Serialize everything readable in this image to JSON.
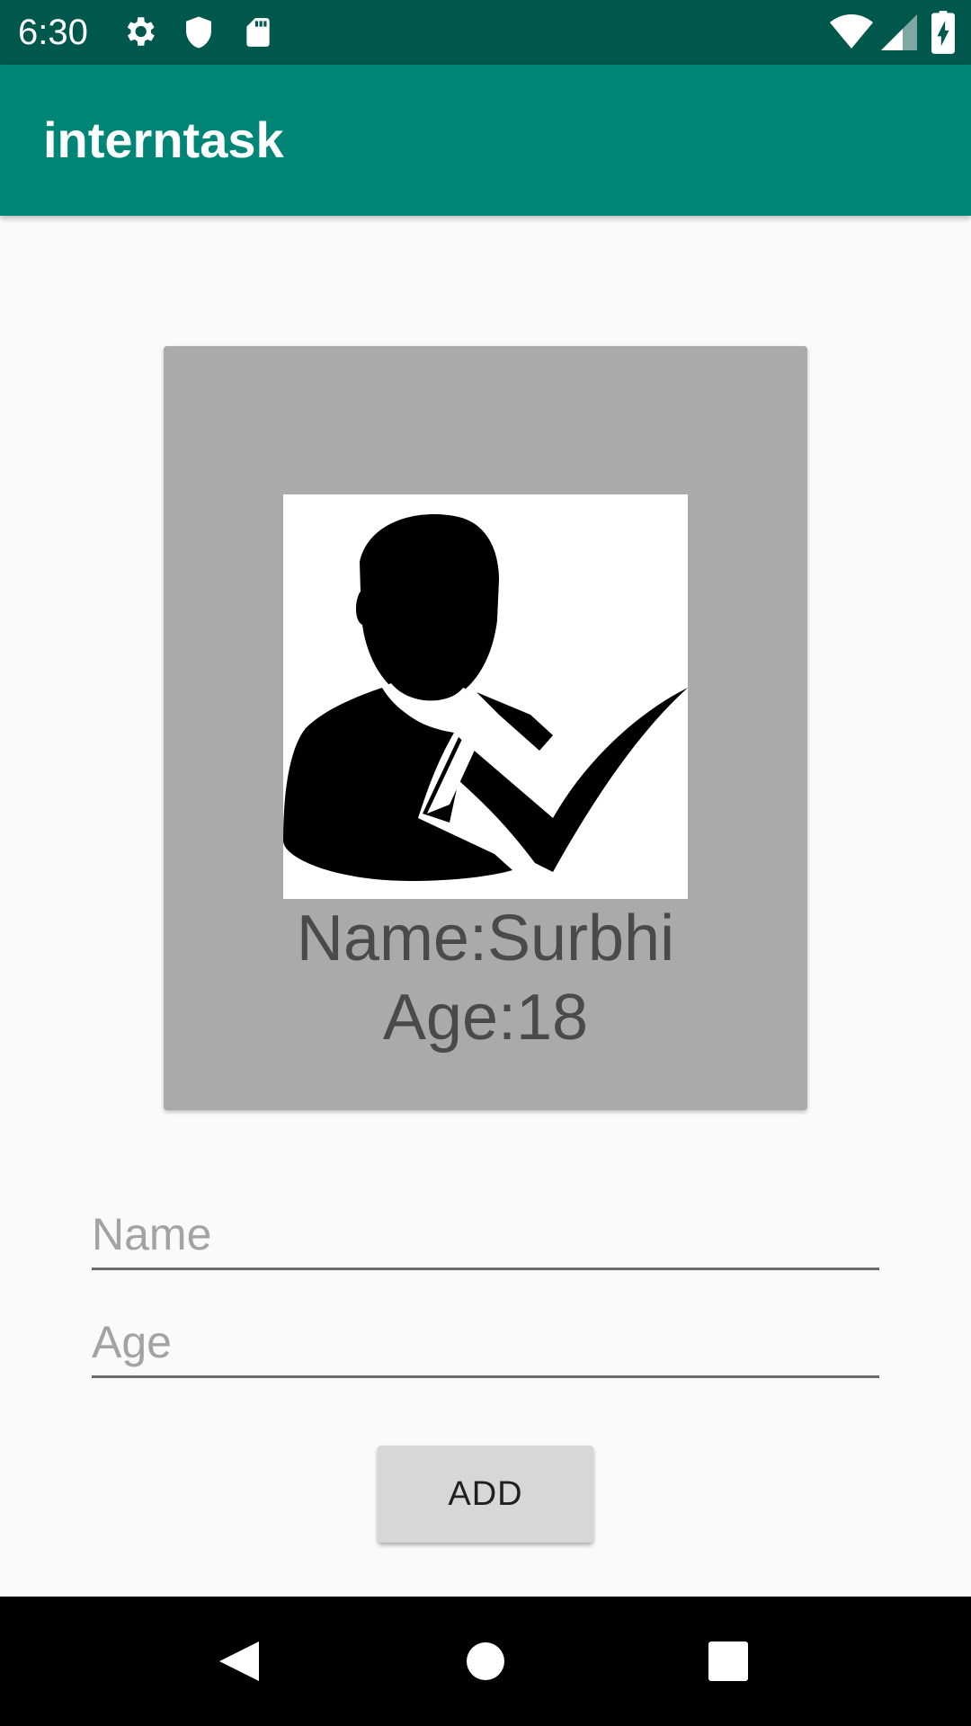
{
  "status_bar": {
    "time": "6:30",
    "icons": [
      "gear-icon",
      "shield-icon",
      "sd-card-icon",
      "wifi-icon",
      "signal-icon",
      "battery-charging-icon"
    ]
  },
  "app_bar": {
    "title": "interntask",
    "color": "#008577"
  },
  "card": {
    "name_text": "Name:Surbhi",
    "age_text": "Age:18",
    "avatar_icon": "person-check-icon",
    "background": "#aba9aa"
  },
  "form": {
    "name_placeholder": "Name",
    "name_value": "",
    "age_placeholder": "Age",
    "age_value": ""
  },
  "add_button": {
    "label": "ADD"
  },
  "nav_bar": {
    "icons": [
      "back-icon",
      "home-icon",
      "recents-icon"
    ]
  }
}
